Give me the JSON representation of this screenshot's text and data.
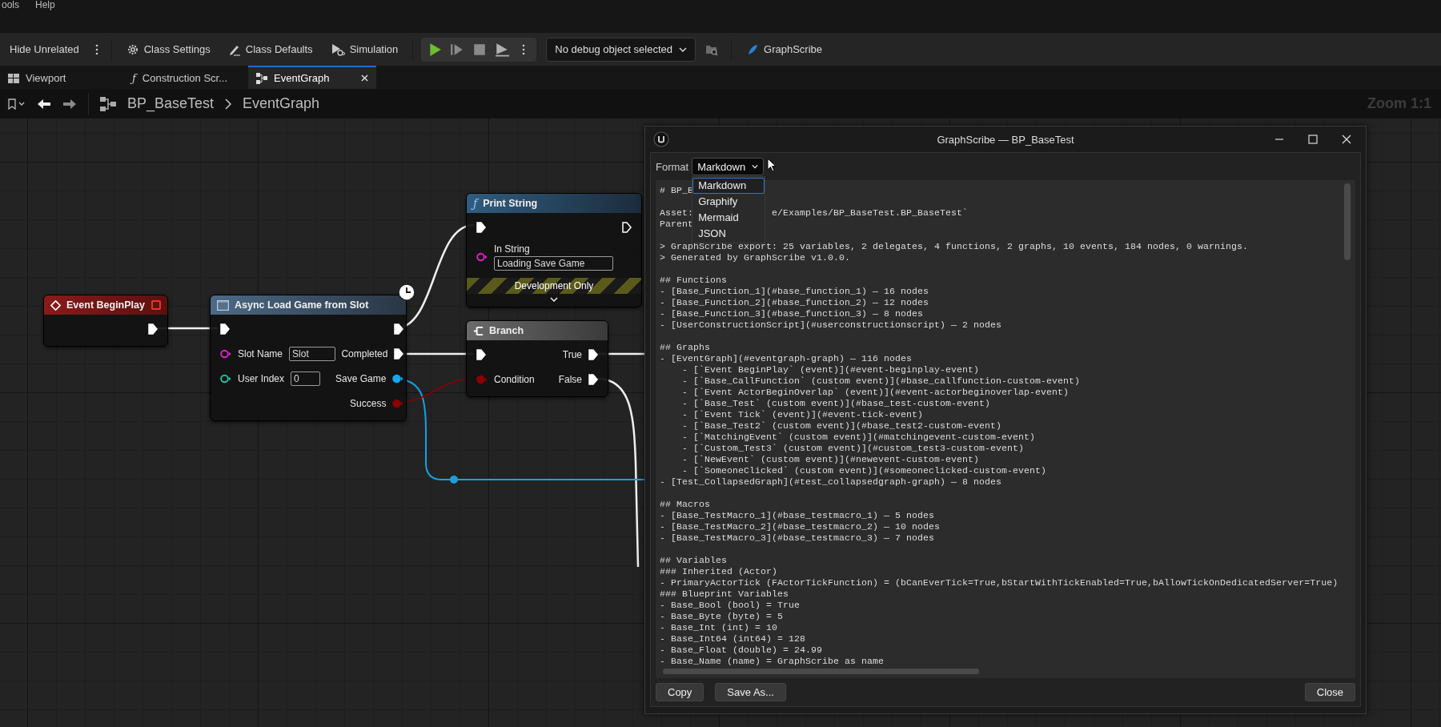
{
  "menu": [
    "ools",
    "Help"
  ],
  "toolbar": {
    "items": [
      {
        "kind": "plain",
        "label": "Hide Unrelated"
      },
      {
        "kind": "gear",
        "label": "Class Settings"
      },
      {
        "kind": "pencil",
        "label": "Class Defaults"
      },
      {
        "kind": "sim",
        "label": "Simulation"
      }
    ],
    "debug_dropdown": "No debug object selected",
    "plugin_button": "GraphScribe"
  },
  "tabs": [
    {
      "kind": "grid",
      "label": "Viewport",
      "selected": false
    },
    {
      "kind": "glyph",
      "glyph": "ƒ",
      "label": "Construction Scr...",
      "selected": false
    },
    {
      "kind": "graph",
      "label": "EventGraph",
      "selected": true,
      "closable": true
    }
  ],
  "breadcrumb": {
    "path": [
      "BP_BaseTest",
      "EventGraph"
    ],
    "zoom": "Zoom 1:1"
  },
  "nodes": [
    {
      "kind": "event",
      "title": "Event BeginPlay",
      "outputs": [
        {
          "kind": "exec",
          "connected": true
        }
      ]
    },
    {
      "kind": "latent",
      "title": "Async Load Game from Slot",
      "inputs": [
        {
          "kind": "exec",
          "connected": true
        },
        {
          "kind": "data",
          "label": "Slot Name",
          "color": "#e020c8",
          "connected": false,
          "value": "Slot"
        },
        {
          "kind": "data",
          "label": "User Index",
          "color": "#20c0a0",
          "connected": false,
          "value": "0"
        }
      ],
      "outputs": [
        {
          "kind": "exec",
          "connected": true
        },
        {
          "kind": "exec",
          "label": "Completed",
          "connected": true
        },
        {
          "kind": "data",
          "label": "Save Game",
          "color": "#10a8f0",
          "connected": true
        },
        {
          "kind": "data",
          "label": "Success",
          "color": "#8c0000",
          "connected": true
        }
      ]
    },
    {
      "kind": "function",
      "glyph": "ƒ",
      "title": "Print String",
      "inputs": [
        {
          "kind": "exec",
          "connected": true
        },
        {
          "kind": "data",
          "label": "In String",
          "color": "#e020c8",
          "connected": false,
          "value": "Loading Save Game",
          "value_below": true
        }
      ],
      "outputs": [
        {
          "kind": "exec",
          "connected": false
        }
      ],
      "banner": "Development Only",
      "collapsible": true
    },
    {
      "kind": "branch",
      "title": "Branch",
      "inputs": [
        {
          "kind": "exec",
          "connected": true
        },
        {
          "kind": "data",
          "label": "Condition",
          "color": "#8c0000",
          "connected": true
        }
      ],
      "outputs": [
        {
          "kind": "exec",
          "label": "True",
          "connected": true
        },
        {
          "kind": "exec",
          "label": "False",
          "connected": true
        }
      ]
    }
  ],
  "dialog": {
    "title": "GraphScribe — BP_BaseTest",
    "format": {
      "label": "Format",
      "value": "Markdown",
      "expanded": true,
      "options": [
        {
          "label": "Markdown",
          "selected": true
        },
        {
          "label": "Graphify",
          "selected": false
        },
        {
          "label": "Mermaid",
          "selected": false
        },
        {
          "label": "JSON",
          "selected": false
        }
      ]
    },
    "blocks": [
      [
        [
          "# BP_B"
        ]
      ],
      [
        [
          "Asset:",
          "e/Examples/BP_BaseTest.BP_BaseTest`"
        ],
        [
          "Parent"
        ]
      ],
      [
        [
          "> GraphScribe export: 25 variables, 2 delegates, 4 functions, 2 graphs, 10 events, 184 nodes, 0 warnings."
        ],
        [
          "> Generated by GraphScribe v1.0.0."
        ]
      ],
      [
        [
          "## Functions"
        ],
        [
          "- [Base_Function_1](#base_function_1) — 16 nodes"
        ],
        [
          "- [Base_Function_2](#base_function_2) — 12 nodes"
        ],
        [
          "- [Base_Function_3](#base_function_3) — 8 nodes"
        ],
        [
          "- [UserConstructionScript](#userconstructionscript) — 2 nodes"
        ]
      ],
      [
        [
          "## Graphs"
        ],
        [
          "- [EventGraph](#eventgraph-graph) — 116 nodes"
        ],
        [
          "    - [`Event BeginPlay` (event)](#event-beginplay-event)"
        ],
        [
          "    - [`Base_CallFunction` (custom event)](#base_callfunction-custom-event)"
        ],
        [
          "    - [`Event ActorBeginOverlap` (event)](#event-actorbeginoverlap-event)"
        ],
        [
          "    - [`Base_Test` (custom event)](#base_test-custom-event)"
        ],
        [
          "    - [`Event Tick` (event)](#event-tick-event)"
        ],
        [
          "    - [`Base_Test2` (custom event)](#base_test2-custom-event)"
        ],
        [
          "    - [`MatchingEvent` (custom event)](#matchingevent-custom-event)"
        ],
        [
          "    - [`Custom_Test3` (custom event)](#custom_test3-custom-event)"
        ],
        [
          "    - [`NewEvent` (custom event)](#newevent-custom-event)"
        ],
        [
          "    - [`SomeoneClicked` (custom event)](#someoneclicked-custom-event)"
        ],
        [
          "- [Test_CollapsedGraph](#test_collapsedgraph-graph) — 8 nodes"
        ]
      ],
      [
        [
          "## Macros"
        ],
        [
          "- [Base_TestMacro_1](#base_testmacro_1) — 5 nodes"
        ],
        [
          "- [Base_TestMacro_2](#base_testmacro_2) — 10 nodes"
        ],
        [
          "- [Base_TestMacro_3](#base_testmacro_3) — 7 nodes"
        ]
      ],
      [
        [
          "## Variables"
        ],
        [
          "### Inherited (Actor)"
        ],
        [
          "- PrimaryActorTick (FActorTickFunction) = (bCanEverTick=True,bStartWithTickEnabled=True,bAllowTickOnDedicatedServer=True)"
        ],
        [
          "### Blueprint Variables"
        ],
        [
          "- Base_Bool (bool) = True"
        ],
        [
          "- Base_Byte (byte) = 5"
        ],
        [
          "- Base_Int (int) = 10"
        ],
        [
          "- Base_Int64 (int64) = 128"
        ],
        [
          "- Base_Float (double) = 24.99"
        ],
        [
          "- Base_Name (name) = GraphScribe as name"
        ]
      ]
    ],
    "left_buttons": [
      "Copy",
      "Save As..."
    ],
    "right_buttons": [
      "Close"
    ]
  }
}
